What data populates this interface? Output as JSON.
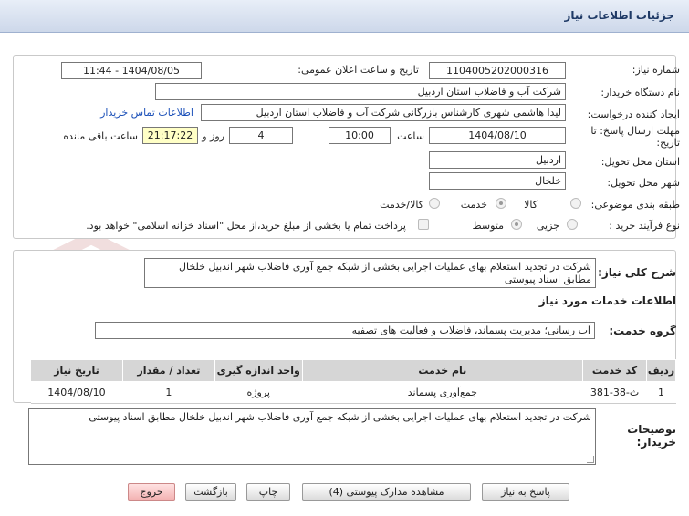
{
  "header": {
    "title": "جزئیات اطلاعات نیاز"
  },
  "info": {
    "need_number_label": "شماره نیاز:",
    "need_number": "1104005202000316",
    "announce_label": "تاریخ و ساعت اعلان عمومی:",
    "announce_value": "1404/08/05 - 11:44",
    "buyer_org_label": "نام دستگاه خریدار:",
    "buyer_org": "شرکت آب و فاضلاب استان اردبیل",
    "creator_label": "ایجاد کننده درخواست:",
    "creator": "لیدا  هاشمی شهری کارشناس بازرگانی شرکت آب و فاضلاب استان اردبیل",
    "contact_link": "اطلاعات تماس خریدار",
    "deadline_label_1": "مهلت ارسال پاسخ: تا",
    "deadline_label_2": "تاریخ:",
    "deadline_date": "1404/08/10",
    "time_label": "ساعت",
    "deadline_time": "10:00",
    "days_value": "4",
    "days_label": "روز و",
    "remaining_value": "21:17:22",
    "remaining_label": "ساعت باقی مانده",
    "province_label": "استان محل تحویل:",
    "province": "اردبیل",
    "city_label": "شهر محل تحویل:",
    "city": "خلخال",
    "category_label": "طبقه بندی موضوعی:",
    "category_options": [
      "کالا",
      "خدمت",
      "کالا/خدمت"
    ],
    "category_selected": "خدمت",
    "process_label": "نوع فرآیند خرید :",
    "process_options": [
      "جزیی",
      "متوسط"
    ],
    "process_selected": "متوسط",
    "payment_note": "پرداخت تمام یا بخشی از مبلغ خرید،از محل \"اسناد خزانه اسلامی\" خواهد بود."
  },
  "summary": {
    "label": "شرح کلی نیاز:",
    "text": "شرکت در تجدید استعلام بهای عملیات اجرایی بخشی از شبکه جمع آوری فاضلاب شهر اندبیل خلخال مطابق اسناد پیوستی"
  },
  "services": {
    "section_title": "اطلاعات خدمات مورد نیاز",
    "group_label": "گروه خدمت:",
    "group_value": "آب رسانی؛ مدیریت پسماند، فاضلاب و فعالیت های تصفیه",
    "columns": [
      "ردیف",
      "کد خدمت",
      "نام خدمت",
      "واحد اندازه گیری",
      "تعداد / مقدار",
      "تاریخ نیاز"
    ],
    "rows": [
      {
        "row": "1",
        "code": "ث-38-381",
        "name": "جمع‌آوری پسماند",
        "unit": "پروژه",
        "qty": "1",
        "date": "1404/08/10"
      }
    ]
  },
  "buyer_notes": {
    "label_1": "توضیحات",
    "label_2": "خریدار:",
    "text": "شرکت در تجدید استعلام بهای عملیات اجرایی بخشی از شبکه جمع آوری فاضلاب شهر اندبیل خلخال مطابق اسناد پیوستی"
  },
  "buttons": {
    "reply": "پاسخ به نیاز",
    "attachments": "مشاهده مدارک پیوستی (4)",
    "print": "چاپ",
    "back": "بازگشت",
    "exit": "خروج"
  },
  "colors": {
    "header_bg": "#cdd8ea",
    "remaining_bg": "#ffffc6",
    "link": "#1a4fb8",
    "exit_button": "#f3b3b3"
  }
}
